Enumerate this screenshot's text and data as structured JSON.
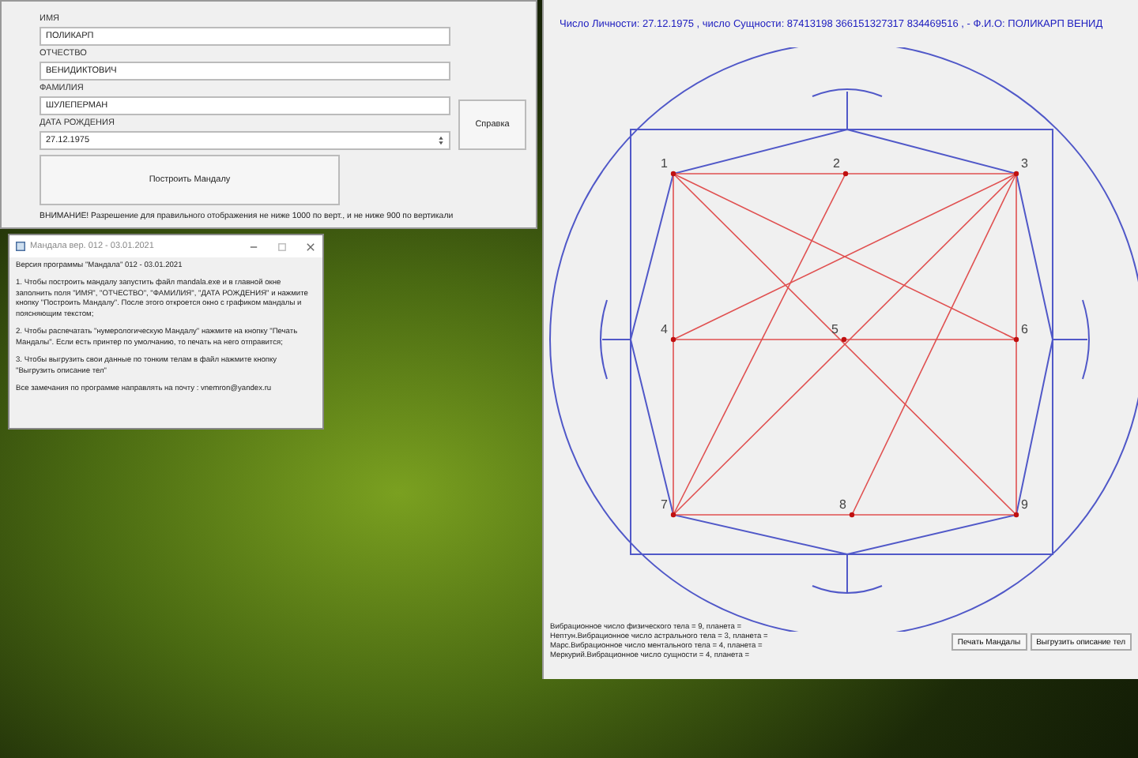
{
  "main_form": {
    "fields": [
      {
        "label": "ИМЯ",
        "value": "ПОЛИКАРП"
      },
      {
        "label": "ОТЧЕСТВО",
        "value": "ВЕНИДИКТОВИЧ"
      },
      {
        "label": "ФАМИЛИЯ",
        "value": "ШУЛЕПЕРМАН"
      },
      {
        "label": "ДАТА РОЖДЕНИЯ",
        "value": "27.12.1975",
        "kind": "spin"
      }
    ],
    "help_button": "Справка",
    "build_button": "Построить Мандалу",
    "warning": "ВНИМАНИЕ! Разрешение для правильного отображения не ниже 1000 по верт., и не ниже 900 по вертикали"
  },
  "help_window": {
    "title": "Мандала вер. 012 - 03.01.2021",
    "paragraphs": [
      "Версия программы \"Мандала\" 012 - 03.01.2021",
      "1. Чтобы построить мандалу запустить файл mandala.exe и в главной окне заполнить поля \"ИМЯ\", \"ОТЧЕСТВО\", \"ФАМИЛИЯ\", \"ДАТА РОЖДЕНИЯ\" и нажмите кнопку \"Построить Мандалу\". После этого откроется окно с графиком мандалы и поясняющим текстом;",
      "2. Чтобы распечатать \"нумерологическую Мандалу\" нажмите на кнопку \"Печать Мандалы\". Если есть принтер по умолчанию, то печать на него отправится;",
      "3. Чтобы выгрузить свои данные по тонким телам в файл нажмите кнопку \"Выгрузить описание тел\"",
      "Все замечания по программе направлять на почту : vnemron@yandex.ru"
    ]
  },
  "mandala_window": {
    "header": "Число Личности: 27.12.1975 , число Сущности:  87413198 366151327317 834469516 , - Ф.И.О: ПОЛИКАРП ВЕНИД",
    "points": [
      "1",
      "2",
      "3",
      "4",
      "5",
      "6",
      "7",
      "8",
      "9"
    ],
    "description": [
      "Вибрационное число физического тела = 9, планета =",
      "Нептун.Вибрационное число астрального тела = 3, планета =",
      "Марс.Вибрационное число ментального тела = 4, планета =",
      "Меркурий.Вибрационное число сущности = 4, планета ="
    ],
    "buttons": [
      "Печать Мандалы",
      "Выгрузить описание тел"
    ]
  }
}
